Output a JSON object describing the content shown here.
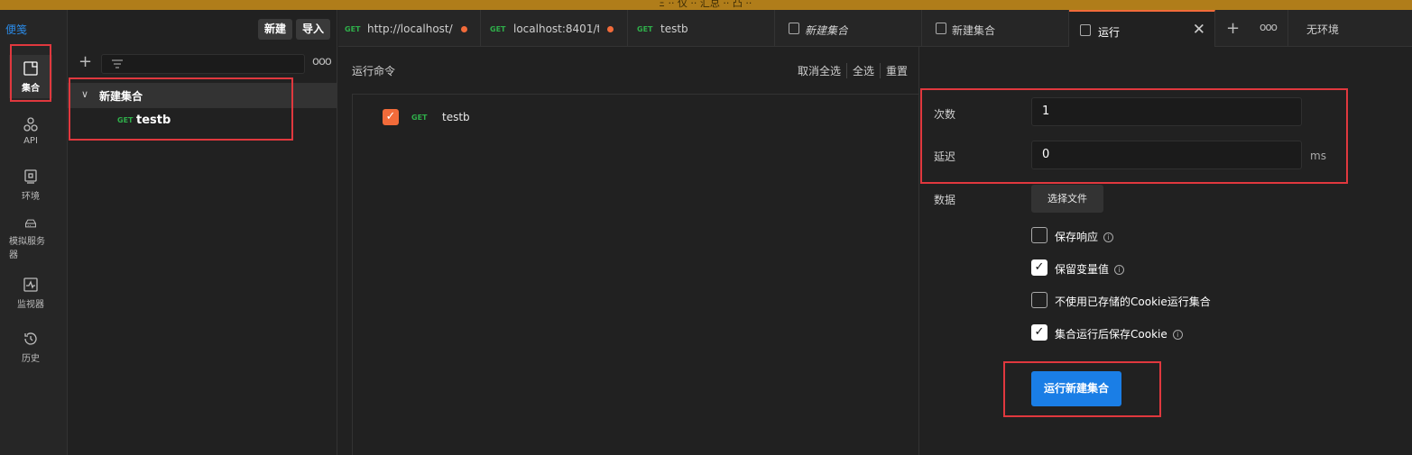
{
  "window": {
    "title": "Ξ ·· 仅 ·· 汇总 ·· 凸 ··"
  },
  "rail": {
    "brand": "便笺",
    "items": [
      {
        "label": "集合",
        "icon": "collection-icon"
      },
      {
        "label": "API",
        "icon": "api-icon"
      },
      {
        "label": "环境",
        "icon": "environment-icon"
      },
      {
        "label": "模拟服务器",
        "icon": "mock-server-icon"
      },
      {
        "label": "监视器",
        "icon": "monitor-icon"
      },
      {
        "label": "历史",
        "icon": "history-icon"
      }
    ]
  },
  "sidebar": {
    "new_label": "新建",
    "import_label": "导入",
    "more": "ooo",
    "collection_name": "新建集合",
    "request": {
      "method": "GET",
      "name": "testb"
    }
  },
  "tabs": [
    {
      "method": "GET",
      "label": "http://localhost/...",
      "dirty": true
    },
    {
      "method": "GET",
      "label": "localhost:8401/t...",
      "dirty": true
    },
    {
      "method": "GET",
      "label": "testb",
      "dirty": false
    },
    {
      "label": "新建集合",
      "italic": true
    },
    {
      "label": "新建集合"
    },
    {
      "label": "运行",
      "active": true
    }
  ],
  "tab_more": "ooo",
  "environment": "无环境",
  "runner": {
    "title": "运行命令",
    "deselect_all": "取消全选",
    "select_all": "全选",
    "reset": "重置",
    "item": {
      "method": "GET",
      "name": "testb",
      "checked": true
    }
  },
  "settings": {
    "iterations_label": "次数",
    "iterations_value": "1",
    "delay_label": "延迟",
    "delay_value": "0",
    "delay_unit": "ms",
    "data_label": "数据",
    "choose_file": "选择文件",
    "options": [
      {
        "label": "保存响应",
        "checked": false,
        "info": true
      },
      {
        "label": "保留变量值",
        "checked": true,
        "info": true
      },
      {
        "label": "不使用已存储的Cookie运行集合",
        "checked": false,
        "info": false
      },
      {
        "label": "集合运行后保存Cookie",
        "checked": true,
        "info": true
      }
    ],
    "run_button": "运行新建集合"
  },
  "colors": {
    "accent": "#f26b3a",
    "primary": "#1a7ee6",
    "annotation": "#e0383e"
  }
}
